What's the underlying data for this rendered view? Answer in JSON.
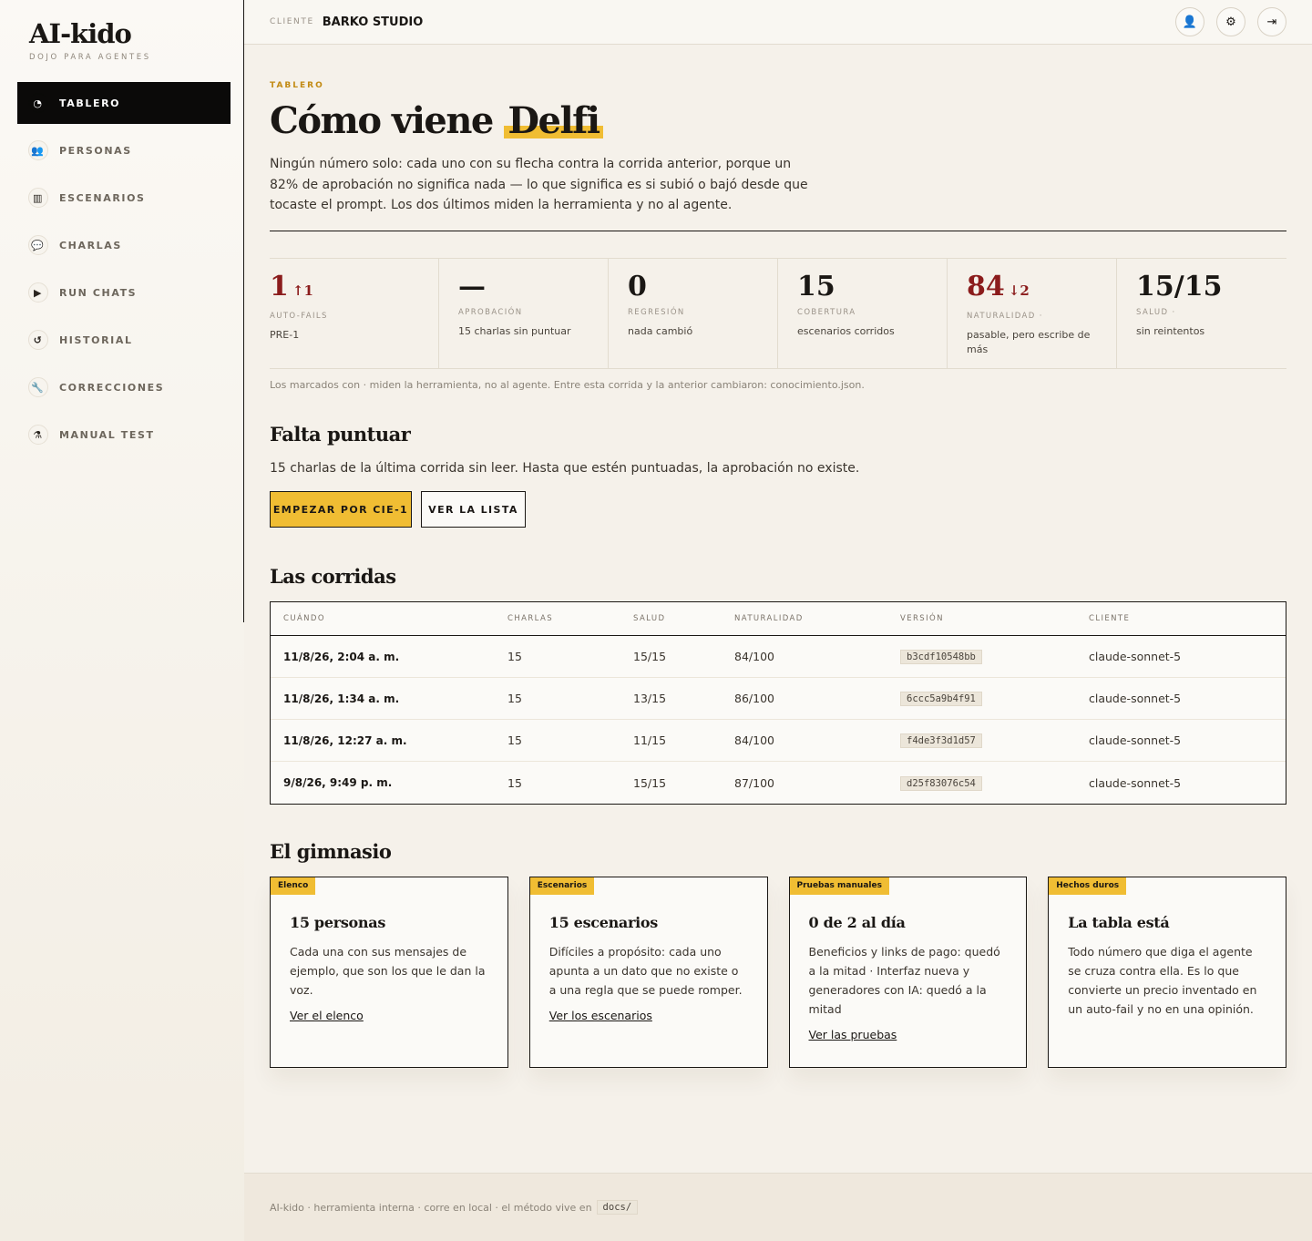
{
  "brand": {
    "title": "AI-kido",
    "subtitle": "DOJO PARA AGENTES"
  },
  "nav": [
    {
      "label": "TABLERO",
      "icon": "dashboard-icon",
      "glyph": "◔",
      "active": true
    },
    {
      "label": "PERSONAS",
      "icon": "people-icon",
      "glyph": "👥",
      "active": false
    },
    {
      "label": "ESCENARIOS",
      "icon": "map-icon",
      "glyph": "▥",
      "active": false
    },
    {
      "label": "CHARLAS",
      "icon": "chat-icon",
      "glyph": "💬",
      "active": false
    },
    {
      "label": "RUN CHATS",
      "icon": "play-icon",
      "glyph": "▶",
      "active": false
    },
    {
      "label": "HISTORIAL",
      "icon": "history-icon",
      "glyph": "↺",
      "active": false
    },
    {
      "label": "CORRECCIONES",
      "icon": "wrench-icon",
      "glyph": "🔧",
      "active": false
    },
    {
      "label": "MANUAL TEST",
      "icon": "flask-icon",
      "glyph": "⚗",
      "active": false
    }
  ],
  "topbar": {
    "client_label": "CLIENTE",
    "client_name": "BARKO STUDIO",
    "actions": [
      {
        "icon": "user-icon",
        "glyph": "👤"
      },
      {
        "icon": "gear-icon",
        "glyph": "⚙"
      },
      {
        "icon": "logout-icon",
        "glyph": "⇥"
      }
    ]
  },
  "header": {
    "eyebrow": "TABLERO",
    "title_start": "Cómo viene",
    "title_highlight": "Delfi",
    "intro": "Ningún número solo: cada uno con su flecha contra la corrida anterior, porque un 82% de aprobación no significa nada — lo que significa es si subió o bajó desde que tocaste el prompt. Los dos últimos miden la herramienta y no al agente."
  },
  "stats": [
    {
      "value": "1",
      "delta": "↑1",
      "red": true,
      "label": "AUTO-FAILS",
      "note": "PRE-1"
    },
    {
      "value": "—",
      "delta": "",
      "red": false,
      "label": "APROBACIÓN",
      "note": "15 charlas sin puntuar"
    },
    {
      "value": "0",
      "delta": "",
      "red": false,
      "label": "REGRESIÓN",
      "note": "nada cambió"
    },
    {
      "value": "15",
      "delta": "",
      "red": false,
      "label": "COBERTURA",
      "note": "escenarios corridos"
    },
    {
      "value": "84",
      "delta": "↓2",
      "red": true,
      "label": "NATURALIDAD ·",
      "note": "pasable, pero escribe de más"
    },
    {
      "value": "15/15",
      "delta": "",
      "red": false,
      "label": "SALUD ·",
      "note": "sin reintentos"
    }
  ],
  "stats_footnote": "Los marcados con · miden la herramienta, no al agente. Entre esta corrida y la anterior cambiaron: conocimiento.json.",
  "pending": {
    "title": "Falta puntuar",
    "text": "15 charlas de la última corrida sin leer. Hasta que estén puntuadas, la aprobación no existe.",
    "primary_label": "EMPEZAR POR CIE-1",
    "secondary_label": "VER LA LISTA"
  },
  "runs": {
    "title": "Las corridas",
    "columns": [
      "CUÁNDO",
      "CHARLAS",
      "SALUD",
      "NATURALIDAD",
      "VERSIÓN",
      "CLIENTE"
    ],
    "rows": [
      [
        "11/8/26, 2:04 a. m.",
        "15",
        "15/15",
        "84/100",
        "b3cdf10548bb",
        "claude-sonnet-5"
      ],
      [
        "11/8/26, 1:34 a. m.",
        "15",
        "13/15",
        "86/100",
        "6ccc5a9b4f91",
        "claude-sonnet-5"
      ],
      [
        "11/8/26, 12:27 a. m.",
        "15",
        "11/15",
        "84/100",
        "f4de3f3d1d57",
        "claude-sonnet-5"
      ],
      [
        "9/8/26, 9:49 p. m.",
        "15",
        "15/15",
        "87/100",
        "d25f83076c54",
        "claude-sonnet-5"
      ]
    ]
  },
  "gym": {
    "title": "El gimnasio",
    "cards": [
      {
        "tag": "Elenco",
        "title": "15 personas",
        "text": "Cada una con sus mensajes de ejemplo, que son los que le dan la voz.",
        "link": "Ver el elenco"
      },
      {
        "tag": "Escenarios",
        "title": "15 escenarios",
        "text": "Difíciles a propósito: cada uno apunta a un dato que no existe o a una regla que se puede romper.",
        "link": "Ver los escenarios"
      },
      {
        "tag": "Pruebas manuales",
        "title": "0 de 2 al día",
        "text": "Beneficios y links de pago: quedó a la mitad · Interfaz nueva y generadores con IA: quedó a la mitad",
        "link": "Ver las pruebas"
      },
      {
        "tag": "Hechos duros",
        "title": "La tabla está",
        "text": "Todo número que diga el agente se cruza contra ella. Es lo que convierte un precio inventado en un auto-fail y no en una opinión.",
        "link": ""
      }
    ]
  },
  "footer": {
    "text": "AI-kido · herramienta interna · corre en local · el método vive en",
    "code": "docs/"
  }
}
